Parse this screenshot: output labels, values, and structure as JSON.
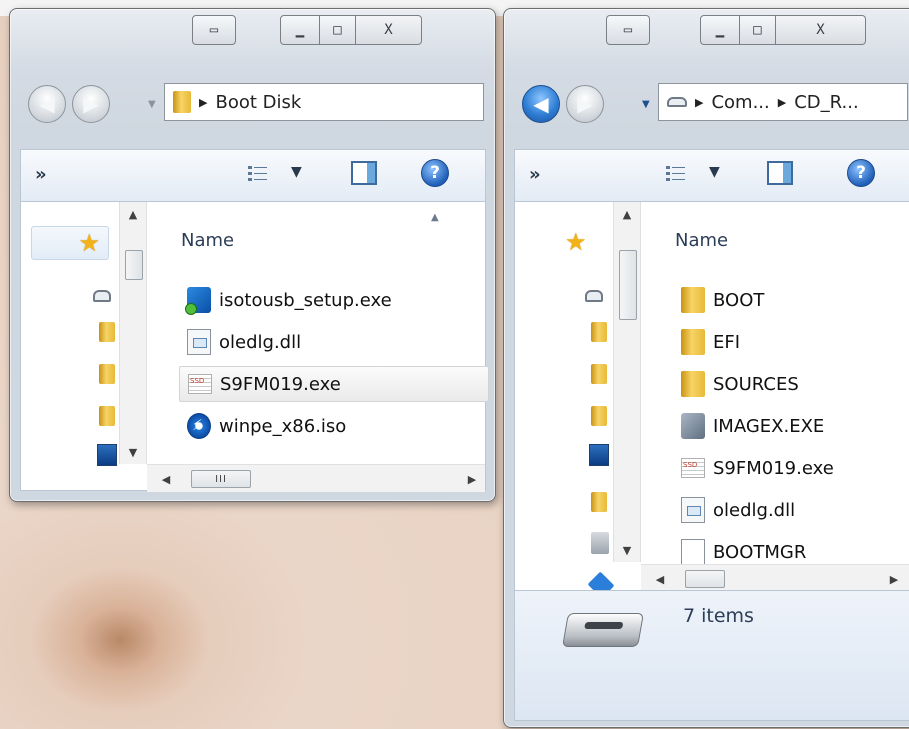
{
  "left_window": {
    "address_crumbs": [
      "Boot Disk"
    ],
    "column_header": "Name",
    "files": [
      {
        "name": "isotousb_setup.exe",
        "icon": "setup-exe-icon"
      },
      {
        "name": "oledlg.dll",
        "icon": "dll-icon"
      },
      {
        "name": "S9FM019.exe",
        "icon": "ssd-exe-icon",
        "selected": true
      },
      {
        "name": "winpe_x86.iso",
        "icon": "iso-icon"
      }
    ],
    "nav_forward_label": "»",
    "scroll_grip": "III"
  },
  "right_window": {
    "address_crumbs": [
      "Com...",
      "CD_R..."
    ],
    "column_header": "Name",
    "files": [
      {
        "name": "BOOT",
        "icon": "folder-icon"
      },
      {
        "name": "EFI",
        "icon": "folder-icon"
      },
      {
        "name": "SOURCES",
        "icon": "folder-icon"
      },
      {
        "name": "IMAGEX.EXE",
        "icon": "imagex-icon"
      },
      {
        "name": "S9FM019.exe",
        "icon": "ssd-exe-icon"
      },
      {
        "name": "oledlg.dll",
        "icon": "dll-icon"
      },
      {
        "name": "BOOTMGR",
        "icon": "blank-file-icon"
      }
    ],
    "nav_forward_label": "»",
    "items_count": "7 items"
  },
  "icons": {
    "back": "back-arrow-icon",
    "forward": "forward-arrow-icon",
    "favorites": "star-icon",
    "help": "help-icon",
    "views": "views-icon",
    "preview_pane": "preview-pane-icon",
    "drive": "removable-drive-icon"
  },
  "colors": {
    "accent_blue": "#2f7fd6",
    "favorites_gold": "#f3b21a",
    "folder_yellow": "#f7d466"
  }
}
